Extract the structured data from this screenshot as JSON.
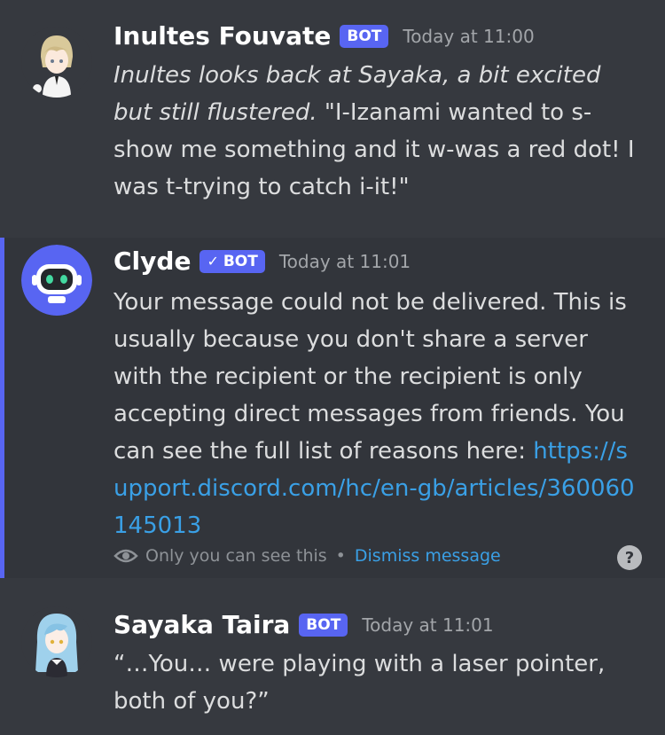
{
  "messages": [
    {
      "author": "Inultes Fouvate",
      "badge": "BOT",
      "timestamp": "Today at 11:00",
      "content_italic": "Inultes looks back at Sayaka, a bit excited but still flustered.",
      "content_text": " \"I-Izanami wanted to s-show me something and it w-was a red dot! I was t-trying to catch i-it!\""
    },
    {
      "author": "Clyde",
      "badge": "BOT",
      "badge_verified": true,
      "timestamp": "Today at 11:01",
      "content_text": "Your message could not be delivered. This is usually because you don't share a server with the recipient or the recipient is only accepting direct messages from friends. You can see the full list of reasons here: ",
      "link": "https://support.discord.com/hc/en-gb/articles/360060145013",
      "ephemeral_note": "Only you can see this",
      "separator": "•",
      "dismiss_label": "Dismiss message",
      "help_label": "?"
    },
    {
      "author": "Sayaka Taira",
      "badge": "BOT",
      "timestamp": "Today at 11:01",
      "content_text": "“…You… were playing with a laser pointer, both of you?”"
    }
  ],
  "colors": {
    "background": "#36393f",
    "highlight_background": "#32353b",
    "accent": "#5865f2",
    "link": "#3aa0e6"
  }
}
